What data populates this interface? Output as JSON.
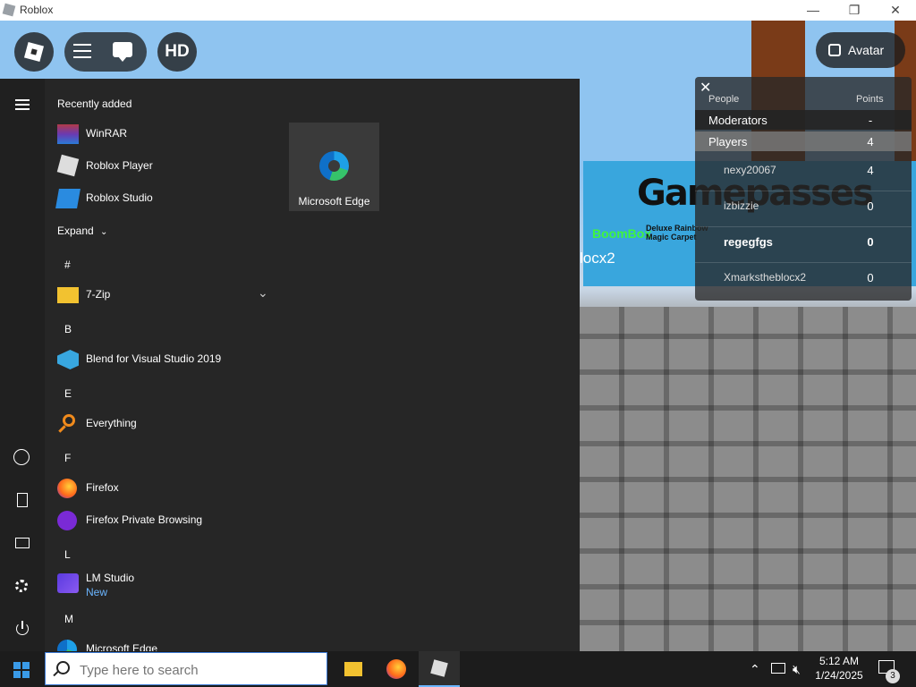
{
  "window": {
    "title": "Roblox",
    "minimize": "—",
    "restore": "❐",
    "close": "✕"
  },
  "game": {
    "banner_title": "Gamepasses",
    "boombox": "BoomBox",
    "carpet": "Deluxe Rainbow Magic Carpet",
    "player_tag": "locx2",
    "hd_label": "HD",
    "avatar_label": "Avatar"
  },
  "leaderboard": {
    "close": "✕",
    "col_people": "People",
    "col_points": "Points",
    "rows": [
      {
        "name": "Moderators",
        "points": "-"
      },
      {
        "name": "Players",
        "points": "4"
      },
      {
        "name": "nexy20067",
        "points": "4"
      },
      {
        "name": "izbizzie",
        "points": "0"
      },
      {
        "name": "regegfgs",
        "points": "0"
      },
      {
        "name": "Xmarkstheblocx2",
        "points": "0"
      }
    ]
  },
  "start_menu": {
    "recently_added": "Recently added",
    "recent": [
      "WinRAR",
      "Roblox Player",
      "Roblox Studio"
    ],
    "expand": "Expand",
    "sections": [
      "#",
      "B",
      "E",
      "F",
      "L",
      "M"
    ],
    "apps": {
      "seven_zip": "7-Zip",
      "blend": "Blend for Visual Studio 2019",
      "everything": "Everything",
      "firefox": "Firefox",
      "firefox_private": "Firefox Private Browsing",
      "lm_studio": "LM Studio",
      "lm_studio_badge": "New",
      "edge": "Microsoft Edge"
    },
    "tile": "Microsoft Edge"
  },
  "taskbar": {
    "search_placeholder": "Type here to search",
    "time": "5:12 AM",
    "date": "1/24/2025",
    "notification_count": "3"
  }
}
